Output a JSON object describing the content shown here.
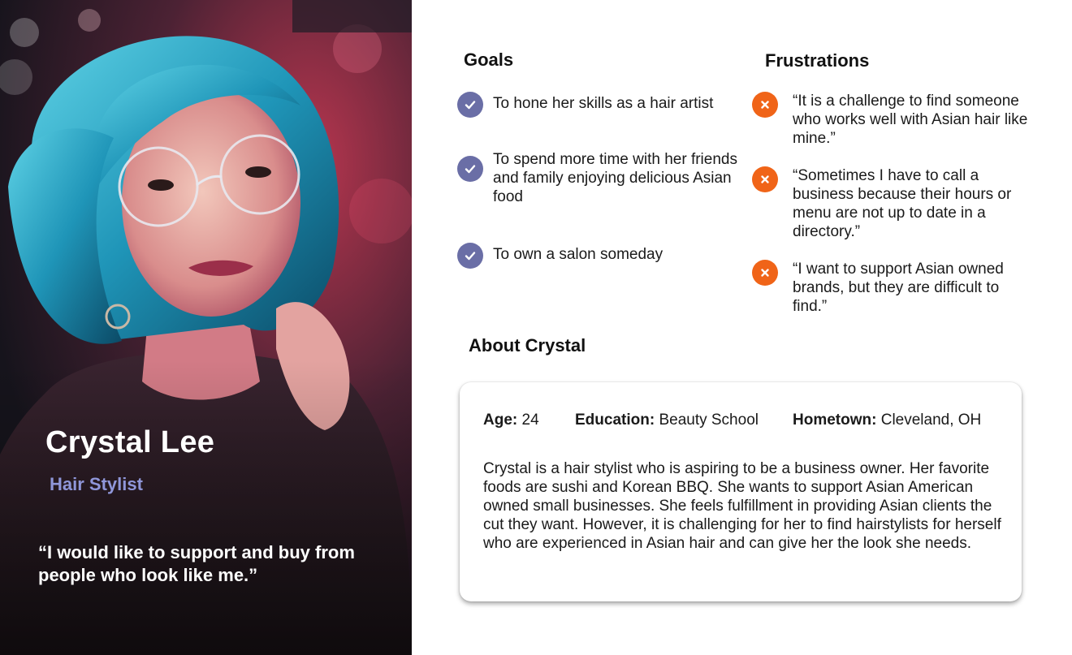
{
  "profile": {
    "name": "Crystal Lee",
    "role": "Hair Stylist",
    "quote": "“I would like to support and buy from people who look like me.”"
  },
  "goals": {
    "heading": "Goals",
    "items": [
      {
        "text": "To hone her skills as a hair artist",
        "icon": "check-icon"
      },
      {
        "text": "To spend more time with her friends and family enjoying delicious Asian food",
        "icon": "check-icon"
      },
      {
        "text": "To own a salon someday",
        "icon": "check-icon"
      }
    ]
  },
  "frustrations": {
    "heading": "Frustrations",
    "items": [
      {
        "text": "“It is a challenge to find someone who works well with Asian hair like mine.”",
        "icon": "x-icon"
      },
      {
        "text": "“Sometimes I have to call a business because their hours or menu are not up to date in a directory.”",
        "icon": "x-icon"
      },
      {
        "text": "“I want to support Asian owned brands, but they are difficult to find.”",
        "icon": "x-icon"
      }
    ]
  },
  "about": {
    "heading": "About Crystal",
    "age_label": "Age:",
    "age": "24",
    "education_label": "Education:",
    "education": "Beauty School",
    "hometown_label": "Hometown:",
    "hometown": "Cleveland, OH",
    "bio": "Crystal is a hair stylist who is aspiring to be a business owner. Her favorite foods are sushi and Korean BBQ. She wants to support Asian American owned small businesses. She feels fulfillment in providing Asian clients the cut they want. However, it is challenging for her to find hairstylists for herself who are experienced in Asian hair and can give her the look she needs."
  },
  "colors": {
    "goal_badge": "#6a6ea6",
    "frustration_badge": "#f06418",
    "role_text": "#8f96d9"
  }
}
